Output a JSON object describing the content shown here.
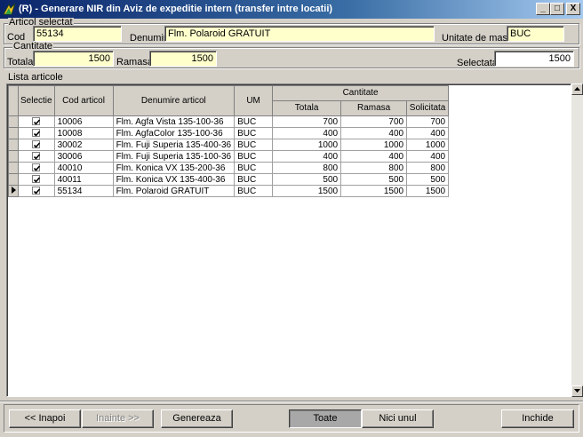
{
  "window": {
    "title": "(R) - Generare NIR din Aviz de expeditie intern (transfer intre locatii)",
    "controls": {
      "minimize": "_",
      "maximize": "□",
      "close": "X"
    }
  },
  "articol_selectat": {
    "legend": "Articol selectat",
    "cod_label": "Cod",
    "cod_value": "55134",
    "denumire_label": "Denumire",
    "denumire_value": "Flm. Polaroid GRATUIT",
    "um_label": "Unitate de masura",
    "um_value": "BUC"
  },
  "cantitate": {
    "legend": "Cantitate",
    "totala_label": "Totala",
    "totala_value": "1500",
    "ramasa_label": "Ramasa",
    "ramasa_value": "1500",
    "selectata_label": "Selectata",
    "selectata_value": "1500"
  },
  "lista": {
    "legend": "Lista articole",
    "headers": {
      "selectie": "Selectie",
      "cod": "Cod articol",
      "denumire": "Denumire articol",
      "um": "UM",
      "cantitate": "Cantitate",
      "totala": "Totala",
      "ramasa": "Ramasa",
      "solicitata": "Solicitata"
    },
    "rows": [
      {
        "selected": true,
        "cod": "10006",
        "denumire": "Flm. Agfa Vista 135-100-36",
        "um": "BUC",
        "totala": "700",
        "ramasa": "700",
        "solicitata": "700"
      },
      {
        "selected": true,
        "cod": "10008",
        "denumire": "Flm. AgfaColor 135-100-36",
        "um": "BUC",
        "totala": "400",
        "ramasa": "400",
        "solicitata": "400"
      },
      {
        "selected": true,
        "cod": "30002",
        "denumire": "Flm. Fuji Superia 135-400-36",
        "um": "BUC",
        "totala": "1000",
        "ramasa": "1000",
        "solicitata": "1000"
      },
      {
        "selected": true,
        "cod": "30006",
        "denumire": "Flm. Fuji Superia 135-100-36",
        "um": "BUC",
        "totala": "400",
        "ramasa": "400",
        "solicitata": "400"
      },
      {
        "selected": true,
        "cod": "40010",
        "denumire": "Flm. Konica VX 135-200-36",
        "um": "BUC",
        "totala": "800",
        "ramasa": "800",
        "solicitata": "800"
      },
      {
        "selected": true,
        "cod": "40011",
        "denumire": "Flm. Konica VX 135-400-36",
        "um": "BUC",
        "totala": "500",
        "ramasa": "500",
        "solicitata": "500"
      },
      {
        "selected": true,
        "cod": "55134",
        "denumire": "Flm. Polaroid GRATUIT",
        "um": "BUC",
        "totala": "1500",
        "ramasa": "1500",
        "solicitata": "1500",
        "current": true
      }
    ]
  },
  "buttons": {
    "inapoi": "<< Inapoi",
    "inainte": "Inainte >>",
    "genereaza": "Genereaza",
    "toate": "Toate",
    "nici_unul": "Nici unul",
    "inchide": "Inchide"
  }
}
